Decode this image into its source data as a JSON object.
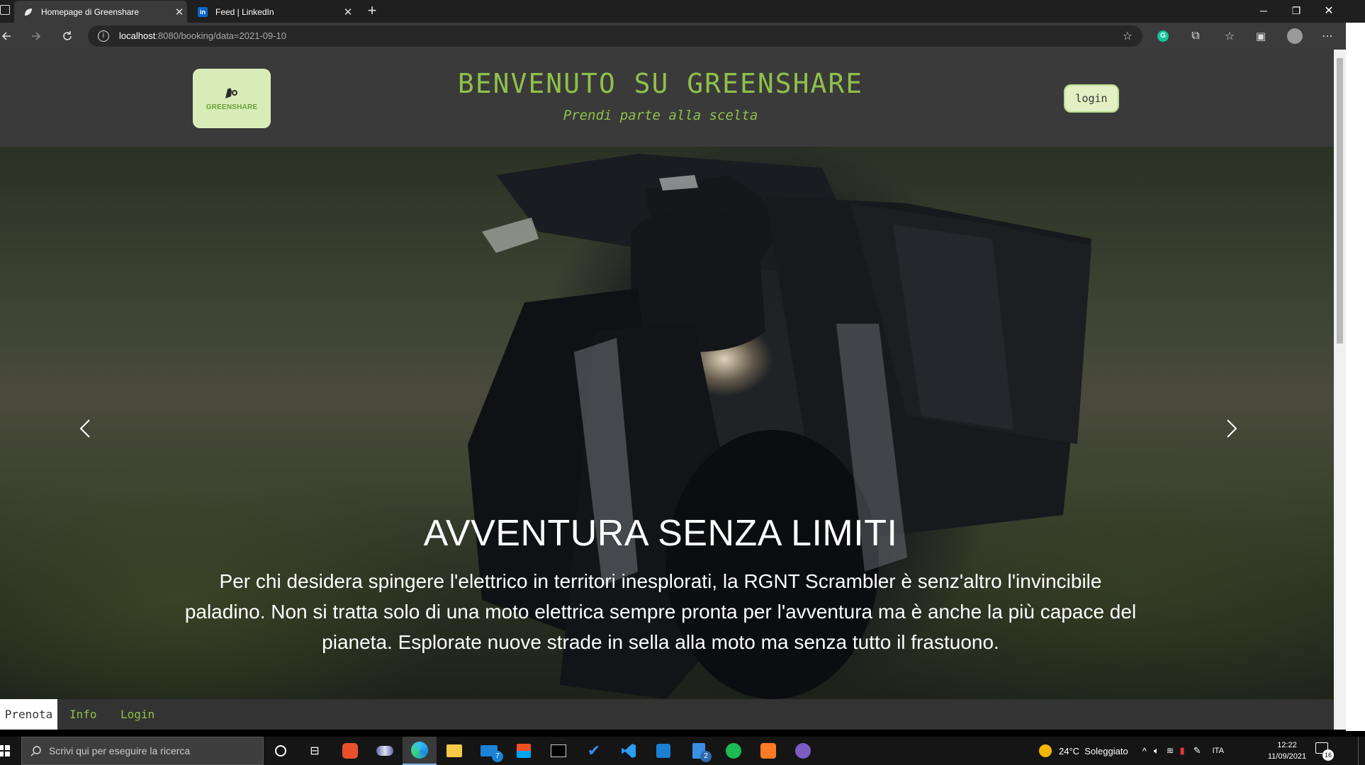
{
  "browser": {
    "tabs": [
      {
        "title": "Homepage di Greenshare",
        "active": true
      },
      {
        "title": "Feed | LinkedIn",
        "active": false
      }
    ],
    "address": {
      "host": "localhost",
      "rest": ":8080/booking/data=2021-09-10"
    }
  },
  "header": {
    "logo_text": "GREENSHARE",
    "title": "BENVENUTO SU GREENSHARE",
    "subtitle": "Prendi parte alla scelta",
    "login_label": "login"
  },
  "hero": {
    "title": "AVVENTURA SENZA LIMITI",
    "text": "Per chi desidera spingere l'elettrico in territori inesplorati, la RGNT Scrambler è senz'altro l'invincibile paladino. Non si tratta solo di una moto elettrica sempre pronta per l'avventura ma è anche la più capace del pianeta. Esplorate nuove strade in sella alla moto ma senza tutto il frastuono."
  },
  "nav": {
    "items": [
      {
        "label": "Prenota",
        "active": true
      },
      {
        "label": "Info",
        "active": false
      },
      {
        "label": "Login",
        "active": false
      }
    ]
  },
  "taskbar": {
    "search_placeholder": "Scrivi qui per eseguire la ricerca",
    "weather": "24°C  Soleggiato",
    "language": "ITA",
    "time": "12:22",
    "date": "11/09/2021",
    "notification_count": "16",
    "mail_badge": "7",
    "chat_badge": "2"
  },
  "colors": {
    "brand_green": "#8fc04a",
    "logo_bg": "#d8ecb8",
    "page_bg": "#3a3a3a"
  }
}
